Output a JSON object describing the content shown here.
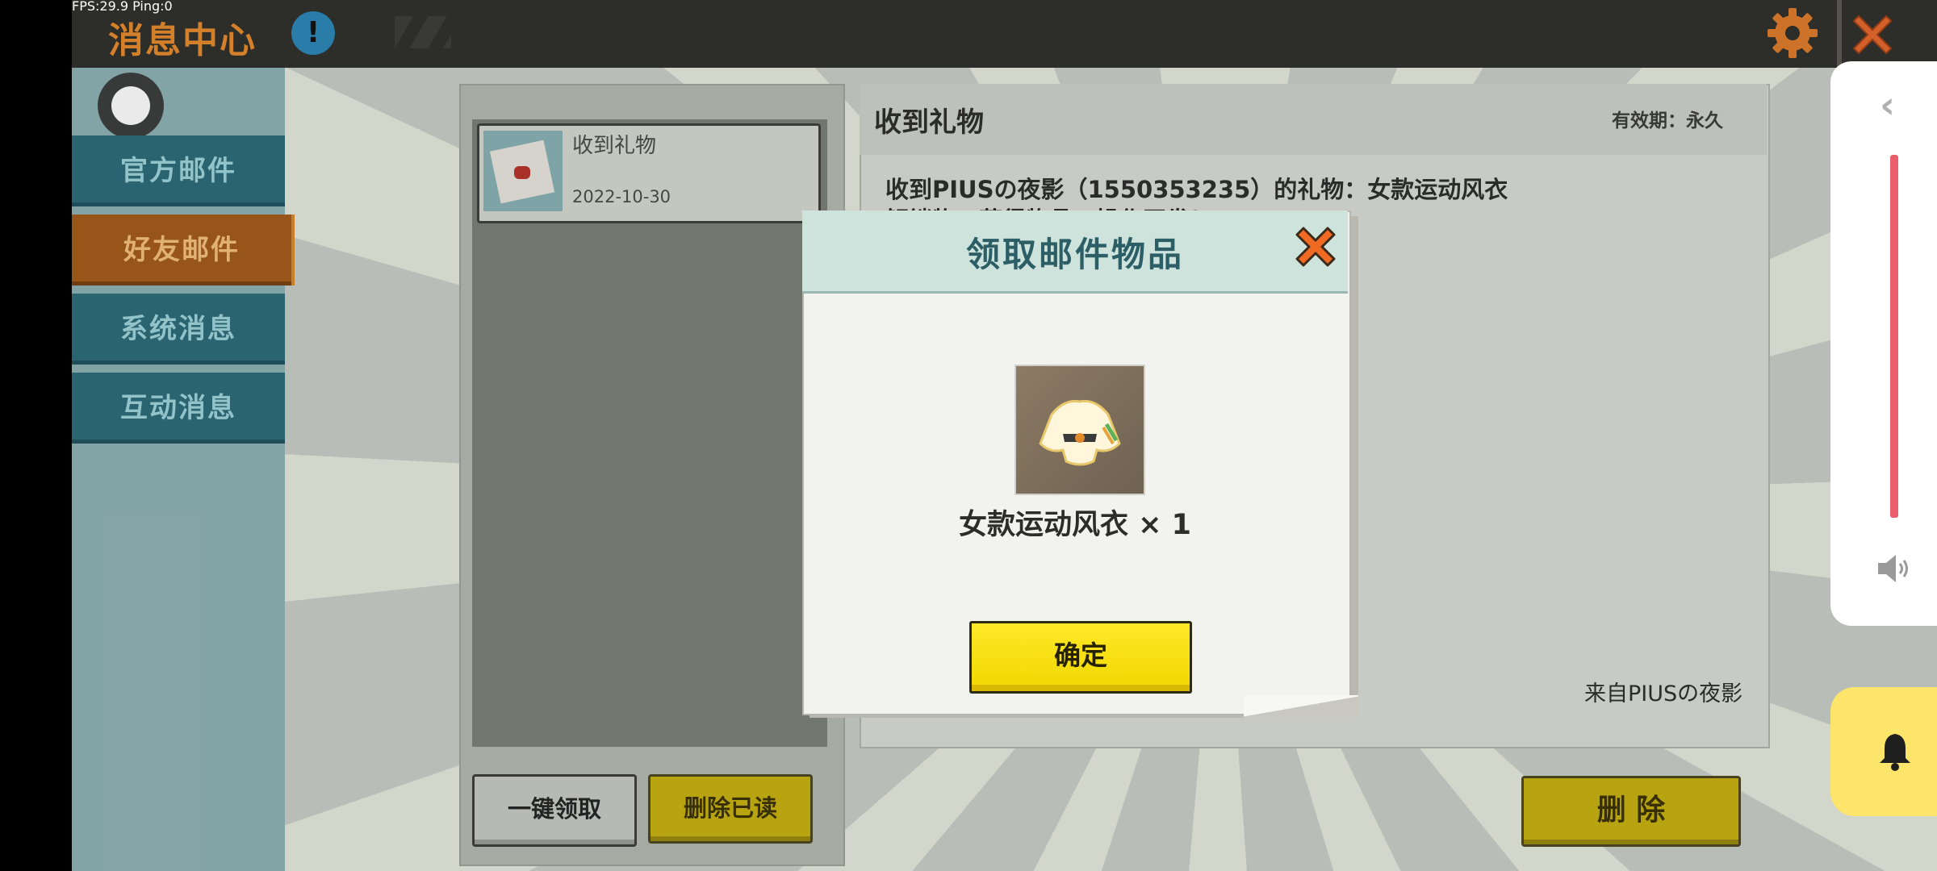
{
  "status_overlay": {
    "fps_text": "FPS:29.9  Ping:0"
  },
  "header": {
    "title": "消息中心",
    "info_glyph": "!"
  },
  "nav": {
    "items": [
      {
        "label": "官方邮件"
      },
      {
        "label": "好友邮件",
        "active": true
      },
      {
        "label": "系统消息"
      },
      {
        "label": "互动消息"
      }
    ]
  },
  "mail_list": {
    "items": [
      {
        "title": "收到礼物",
        "date": "2022-10-30"
      }
    ],
    "claim_all_label": "一键领取",
    "delete_read_label": "删除已读"
  },
  "detail": {
    "title": "收到礼物",
    "validity": "有效期：永久",
    "body_line1": "收到PIUSの夜影（1550353235）的礼物：女款运动风衣",
    "body_line2": "解锁物，获得物品，操作开发！",
    "sender": "来自PIUSの夜影",
    "delete_label": "删 除"
  },
  "modal": {
    "title": "领取邮件物品",
    "item_name": "女款运动风衣 × 1",
    "confirm_label": "确定"
  },
  "floating": {
    "volume_back_glyph": "‹"
  },
  "icons": {
    "settings": "gear-icon",
    "close": "close-icon",
    "info": "info-icon",
    "speaker": "speaker-icon",
    "bell": "bell-icon"
  },
  "colors": {
    "accent_orange": "#e8892b",
    "nav_blue": "#2b6a79",
    "button_yellow": "#f1d800",
    "volume_red": "#ea5d6b",
    "bell_yellow": "#fde56c"
  }
}
